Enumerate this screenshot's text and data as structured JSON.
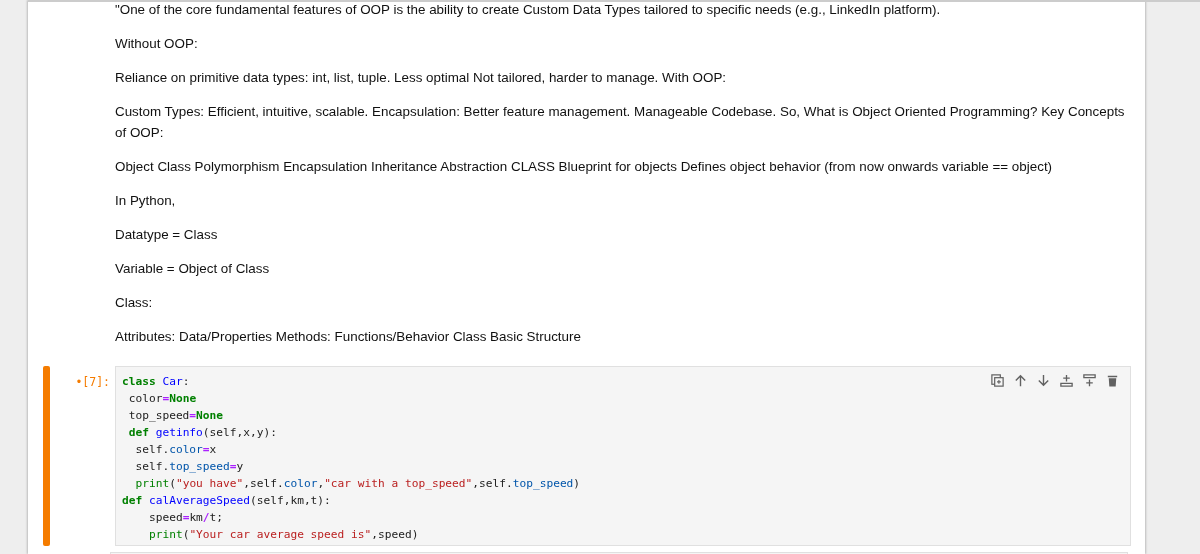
{
  "paragraphs": [
    "\"One of the core fundamental features of OOP is the ability to create Custom Data Types tailored to specific needs (e.g., LinkedIn platform).",
    "Without OOP:",
    "Reliance on primitive data types: int, list, tuple. Less optimal Not tailored, harder to manage. With OOP:",
    "Custom Types: Efficient, intuitive, scalable. Encapsulation: Better feature management. Manageable Codebase. So, What is Object Oriented Programming? Key Concepts of OOP:",
    "Object Class Polymorphism Encapsulation Inheritance Abstraction CLASS Blueprint for objects Defines object behavior (from now onwards variable == object)",
    "In Python,",
    "Datatype = Class",
    "Variable = Object of Class",
    "Class:",
    "Attributes: Data/Properties Methods: Functions/Behavior Class Basic Structure"
  ],
  "cell": {
    "selected": true,
    "prompt": "•[7]:",
    "lines": [
      [
        {
          "kind": "kw",
          "text": "class "
        },
        {
          "kind": "def",
          "text": "Car"
        },
        {
          "kind": "plain",
          "text": ":"
        }
      ],
      [
        {
          "kind": "plain",
          "text": " color"
        },
        {
          "kind": "op",
          "text": "="
        },
        {
          "kind": "kw",
          "text": "None"
        }
      ],
      [
        {
          "kind": "plain",
          "text": " top_speed"
        },
        {
          "kind": "op",
          "text": "="
        },
        {
          "kind": "kw",
          "text": "None"
        }
      ],
      [
        {
          "kind": "kw",
          "text": " def "
        },
        {
          "kind": "def",
          "text": "getinfo"
        },
        {
          "kind": "plain",
          "text": "(self,x,y):"
        }
      ],
      [
        {
          "kind": "plain",
          "text": "  self."
        },
        {
          "kind": "attr",
          "text": "color"
        },
        {
          "kind": "op",
          "text": "="
        },
        {
          "kind": "plain",
          "text": "x"
        }
      ],
      [
        {
          "kind": "plain",
          "text": "  self."
        },
        {
          "kind": "attr",
          "text": "top_speed"
        },
        {
          "kind": "op",
          "text": "="
        },
        {
          "kind": "plain",
          "text": "y"
        }
      ],
      [
        {
          "kind": "builtin",
          "text": "  print"
        },
        {
          "kind": "plain",
          "text": "("
        },
        {
          "kind": "str",
          "text": "\"you have\""
        },
        {
          "kind": "plain",
          "text": ",self."
        },
        {
          "kind": "attr",
          "text": "color"
        },
        {
          "kind": "plain",
          "text": ","
        },
        {
          "kind": "str",
          "text": "\"car with a top_speed\""
        },
        {
          "kind": "plain",
          "text": ",self."
        },
        {
          "kind": "attr",
          "text": "top_speed"
        },
        {
          "kind": "plain",
          "text": ")"
        }
      ],
      [
        {
          "kind": "kw",
          "text": "def "
        },
        {
          "kind": "def",
          "text": "calAverageSpeed"
        },
        {
          "kind": "plain",
          "text": "(self,km,t):"
        }
      ],
      [
        {
          "kind": "plain",
          "text": "    speed"
        },
        {
          "kind": "op",
          "text": "="
        },
        {
          "kind": "plain",
          "text": "km"
        },
        {
          "kind": "op",
          "text": "/"
        },
        {
          "kind": "plain",
          "text": "t;"
        }
      ],
      [
        {
          "kind": "builtin",
          "text": "    print"
        },
        {
          "kind": "plain",
          "text": "("
        },
        {
          "kind": "str",
          "text": "\"Your car average speed is\""
        },
        {
          "kind": "plain",
          "text": ",speed)"
        }
      ]
    ]
  }
}
